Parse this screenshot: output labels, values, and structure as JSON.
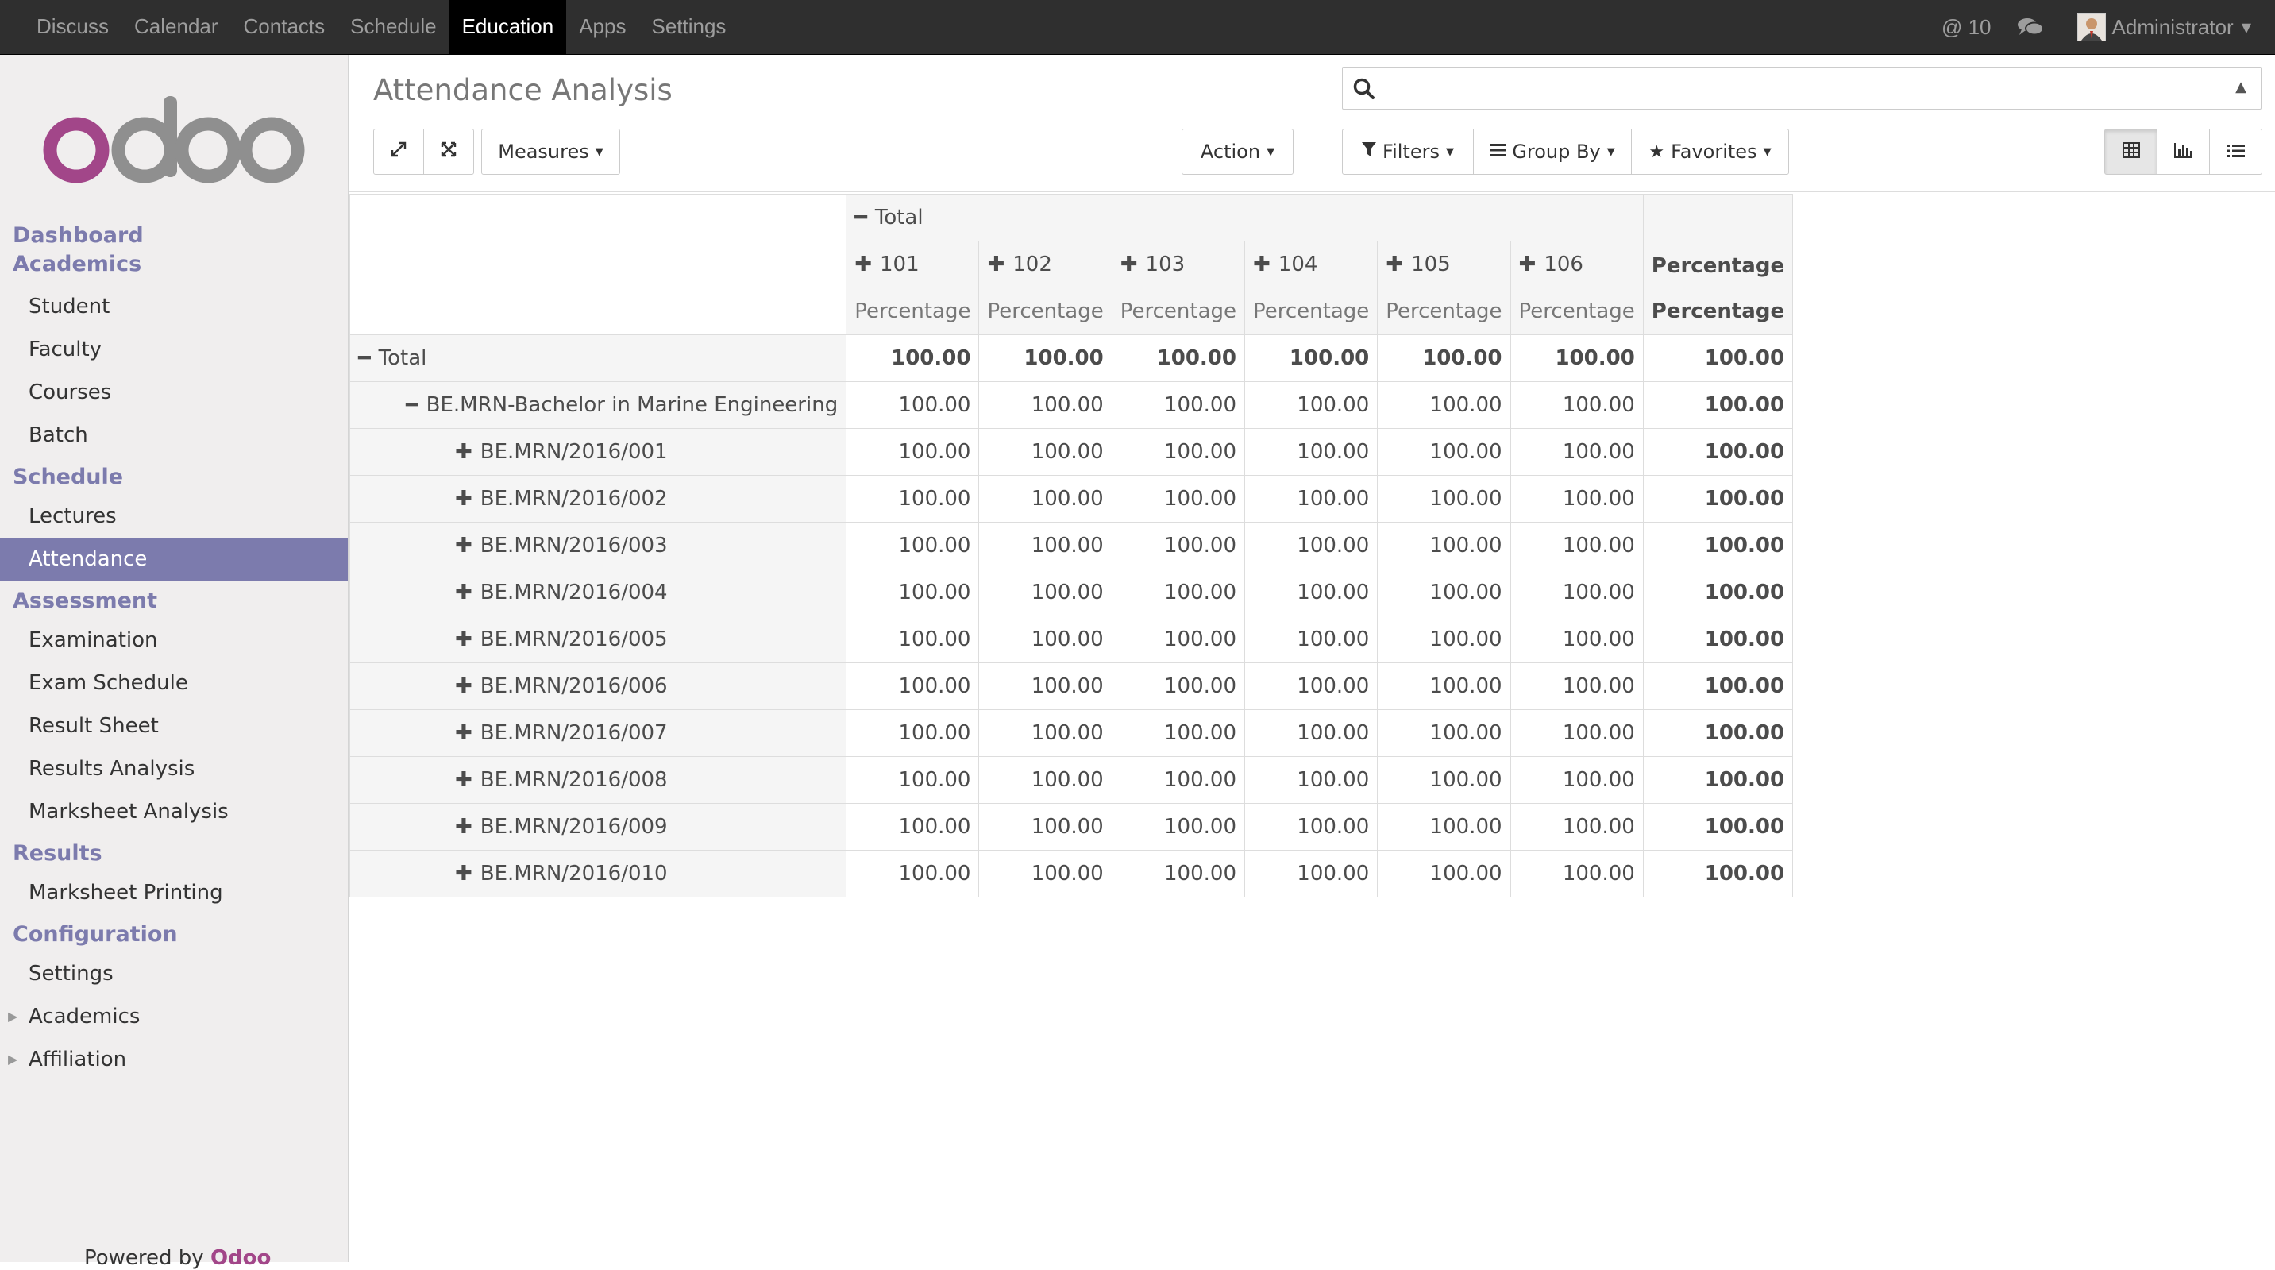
{
  "topbar": {
    "menu": [
      "Discuss",
      "Calendar",
      "Contacts",
      "Schedule",
      "Education",
      "Apps",
      "Settings"
    ],
    "active_menu": "Education",
    "mentions": "@ 10",
    "user": "Administrator"
  },
  "sidebar": {
    "logo_text": "odoo",
    "sections": [
      {
        "title": "Dashboard Academics",
        "items": [
          "Student",
          "Faculty",
          "Courses",
          "Batch"
        ]
      },
      {
        "title": "Schedule",
        "items": [
          "Lectures",
          "Attendance"
        ]
      },
      {
        "title": "Assessment",
        "items": [
          "Examination",
          "Exam Schedule",
          "Result Sheet",
          "Results Analysis",
          "Marksheet Analysis"
        ]
      },
      {
        "title": "Results",
        "items": [
          "Marksheet Printing"
        ]
      },
      {
        "title": "Configuration",
        "items": [
          "Settings",
          "Academics",
          "Affiliation"
        ]
      }
    ],
    "active_item": "Attendance",
    "powered_by": "Powered by",
    "powered_brand": "Odoo"
  },
  "control_panel": {
    "title": "Attendance Analysis",
    "measures_label": "Measures",
    "action_label": "Action",
    "filters_label": "Filters",
    "groupby_label": "Group By",
    "favorites_label": "Favorites",
    "search_placeholder": ""
  },
  "pivot": {
    "col_total_label": "Total",
    "columns": [
      "101",
      "102",
      "103",
      "104",
      "105",
      "106"
    ],
    "measure_label": "Percentage",
    "total_row": {
      "label": "Total",
      "values": [
        "100.00",
        "100.00",
        "100.00",
        "100.00",
        "100.00",
        "100.00"
      ],
      "total": "100.00"
    },
    "group_row": {
      "label": "BE.MRN-Bachelor in Marine Engineering",
      "values": [
        "100.00",
        "100.00",
        "100.00",
        "100.00",
        "100.00",
        "100.00"
      ],
      "total": "100.00"
    },
    "rows": [
      {
        "label": "BE.MRN/2016/001",
        "values": [
          "100.00",
          "100.00",
          "100.00",
          "100.00",
          "100.00",
          "100.00"
        ],
        "total": "100.00"
      },
      {
        "label": "BE.MRN/2016/002",
        "values": [
          "100.00",
          "100.00",
          "100.00",
          "100.00",
          "100.00",
          "100.00"
        ],
        "total": "100.00"
      },
      {
        "label": "BE.MRN/2016/003",
        "values": [
          "100.00",
          "100.00",
          "100.00",
          "100.00",
          "100.00",
          "100.00"
        ],
        "total": "100.00"
      },
      {
        "label": "BE.MRN/2016/004",
        "values": [
          "100.00",
          "100.00",
          "100.00",
          "100.00",
          "100.00",
          "100.00"
        ],
        "total": "100.00"
      },
      {
        "label": "BE.MRN/2016/005",
        "values": [
          "100.00",
          "100.00",
          "100.00",
          "100.00",
          "100.00",
          "100.00"
        ],
        "total": "100.00"
      },
      {
        "label": "BE.MRN/2016/006",
        "values": [
          "100.00",
          "100.00",
          "100.00",
          "100.00",
          "100.00",
          "100.00"
        ],
        "total": "100.00"
      },
      {
        "label": "BE.MRN/2016/007",
        "values": [
          "100.00",
          "100.00",
          "100.00",
          "100.00",
          "100.00",
          "100.00"
        ],
        "total": "100.00"
      },
      {
        "label": "BE.MRN/2016/008",
        "values": [
          "100.00",
          "100.00",
          "100.00",
          "100.00",
          "100.00",
          "100.00"
        ],
        "total": "100.00"
      },
      {
        "label": "BE.MRN/2016/009",
        "values": [
          "100.00",
          "100.00",
          "100.00",
          "100.00",
          "100.00",
          "100.00"
        ],
        "total": "100.00"
      },
      {
        "label": "BE.MRN/2016/010",
        "values": [
          "100.00",
          "100.00",
          "100.00",
          "100.00",
          "100.00",
          "100.00"
        ],
        "total": "100.00"
      }
    ]
  },
  "colors": {
    "topbar_bg": "#2f2f2f",
    "accent": "#7c7bad",
    "brand": "#a24689"
  }
}
